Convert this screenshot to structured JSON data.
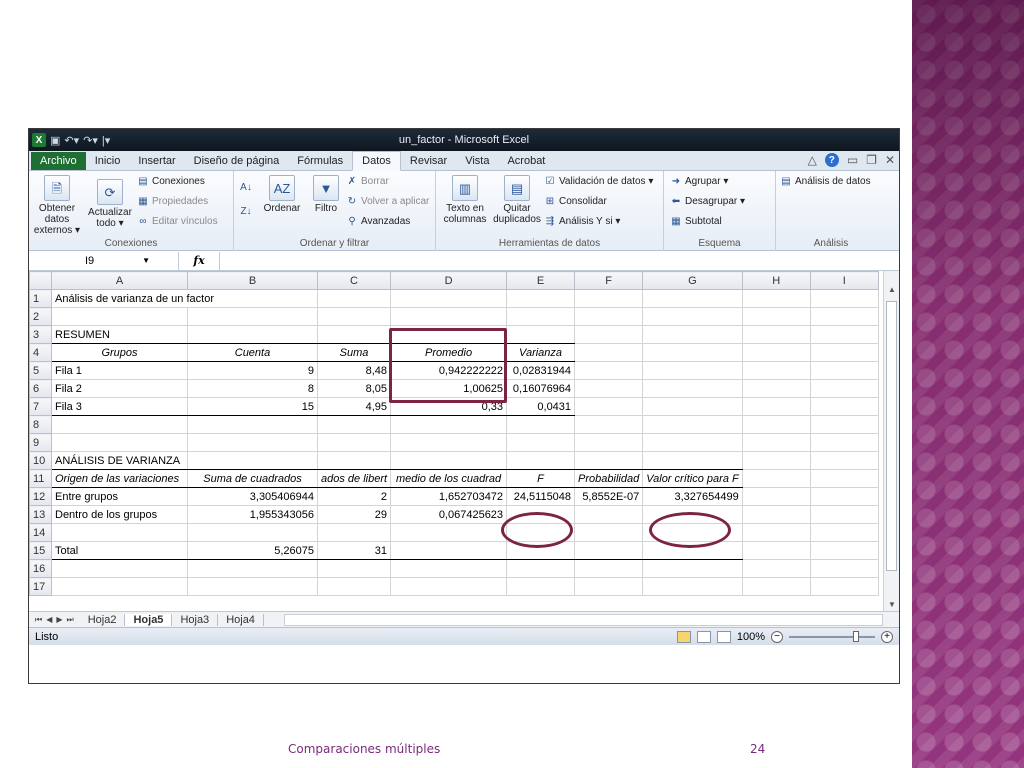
{
  "app": {
    "title": "un_factor - Microsoft Excel",
    "qat_icons": [
      "excel-icon",
      "save-icon",
      "undo-icon",
      "redo-icon"
    ]
  },
  "tabs": [
    "Archivo",
    "Inicio",
    "Insertar",
    "Diseño de página",
    "Fórmulas",
    "Datos",
    "Revisar",
    "Vista",
    "Acrobat"
  ],
  "ribbon": {
    "conexiones": {
      "obtener_line1": "Obtener datos",
      "obtener_line2": "externos ▾",
      "actualizar_line1": "Actualizar",
      "actualizar_line2": "todo ▾",
      "conexiones": "Conexiones",
      "propiedades": "Propiedades",
      "editar": "Editar vínculos",
      "label": "Conexiones"
    },
    "ordenar": {
      "ordenar": "Ordenar",
      "filtro": "Filtro",
      "borrar": "Borrar",
      "volver": "Volver a aplicar",
      "avanzadas": "Avanzadas",
      "label": "Ordenar y filtrar"
    },
    "herramientas": {
      "texto_line1": "Texto en",
      "texto_line2": "columnas",
      "quitar_line1": "Quitar",
      "quitar_line2": "duplicados",
      "validacion": "Validación de datos ▾",
      "consolidar": "Consolidar",
      "analisis_ysi": "Análisis Y si ▾",
      "label": "Herramientas de datos"
    },
    "esquema": {
      "agrupar": "Agrupar ▾",
      "desagrupar": "Desagrupar ▾",
      "subtotal": "Subtotal",
      "label": "Esquema"
    },
    "analisis": {
      "analisis_datos": "Análisis de datos",
      "label": "Análisis"
    }
  },
  "formula_bar": {
    "name_box": "I9",
    "fx": "fx",
    "formula": ""
  },
  "columns": [
    "A",
    "B",
    "C",
    "D",
    "E",
    "F",
    "G",
    "H",
    "I"
  ],
  "rows": [
    {
      "n": "1",
      "cells": [
        "Análisis de varianza de un factor",
        "",
        "",
        "",
        "",
        "",
        "",
        "",
        ""
      ]
    },
    {
      "n": "2",
      "cells": [
        "",
        "",
        "",
        "",
        "",
        "",
        "",
        "",
        ""
      ]
    },
    {
      "n": "3",
      "cells": [
        "RESUMEN",
        "",
        "",
        "",
        "",
        "",
        "",
        "",
        ""
      ]
    },
    {
      "n": "4",
      "cells": [
        "Grupos",
        "Cuenta",
        "Suma",
        "Promedio",
        "Varianza",
        "",
        "",
        "",
        ""
      ]
    },
    {
      "n": "5",
      "cells": [
        "Fila 1",
        "9",
        "8,48",
        "0,942222222",
        "0,02831944",
        "",
        "",
        "",
        ""
      ]
    },
    {
      "n": "6",
      "cells": [
        "Fila 2",
        "8",
        "8,05",
        "1,00625",
        "0,16076964",
        "",
        "",
        "",
        ""
      ]
    },
    {
      "n": "7",
      "cells": [
        "Fila 3",
        "15",
        "4,95",
        "0,33",
        "0,0431",
        "",
        "",
        "",
        ""
      ]
    },
    {
      "n": "8",
      "cells": [
        "",
        "",
        "",
        "",
        "",
        "",
        "",
        "",
        ""
      ]
    },
    {
      "n": "9",
      "cells": [
        "",
        "",
        "",
        "",
        "",
        "",
        "",
        "",
        ""
      ]
    },
    {
      "n": "10",
      "cells": [
        "ANÁLISIS DE VARIANZA",
        "",
        "",
        "",
        "",
        "",
        "",
        "",
        ""
      ]
    },
    {
      "n": "11",
      "cells": [
        "Origen de las variaciones",
        "Suma de cuadrados",
        "ados de libert",
        "medio de los cuadrad",
        "F",
        "Probabilidad",
        "Valor crítico para F",
        "",
        ""
      ]
    },
    {
      "n": "12",
      "cells": [
        "Entre grupos",
        "3,305406944",
        "2",
        "1,652703472",
        "24,5115048",
        "5,8552E-07",
        "3,327654499",
        "",
        ""
      ]
    },
    {
      "n": "13",
      "cells": [
        "Dentro de los grupos",
        "1,955343056",
        "29",
        "0,067425623",
        "",
        "",
        "",
        "",
        ""
      ]
    },
    {
      "n": "14",
      "cells": [
        "",
        "",
        "",
        "",
        "",
        "",
        "",
        "",
        ""
      ]
    },
    {
      "n": "15",
      "cells": [
        "Total",
        "5,26075",
        "31",
        "",
        "",
        "",
        "",
        "",
        ""
      ]
    },
    {
      "n": "16",
      "cells": [
        "",
        "",
        "",
        "",
        "",
        "",
        "",
        "",
        ""
      ]
    },
    {
      "n": "17",
      "cells": [
        "",
        "",
        "",
        "",
        "",
        "",
        "",
        "",
        ""
      ]
    }
  ],
  "sheet_tabs": [
    "Hoja2",
    "Hoja5",
    "Hoja3",
    "Hoja4"
  ],
  "active_sheet": "Hoja5",
  "status": {
    "ready": "Listo",
    "zoom": "100%"
  },
  "footer": {
    "caption": "Comparaciones múltiples",
    "page": "24"
  }
}
